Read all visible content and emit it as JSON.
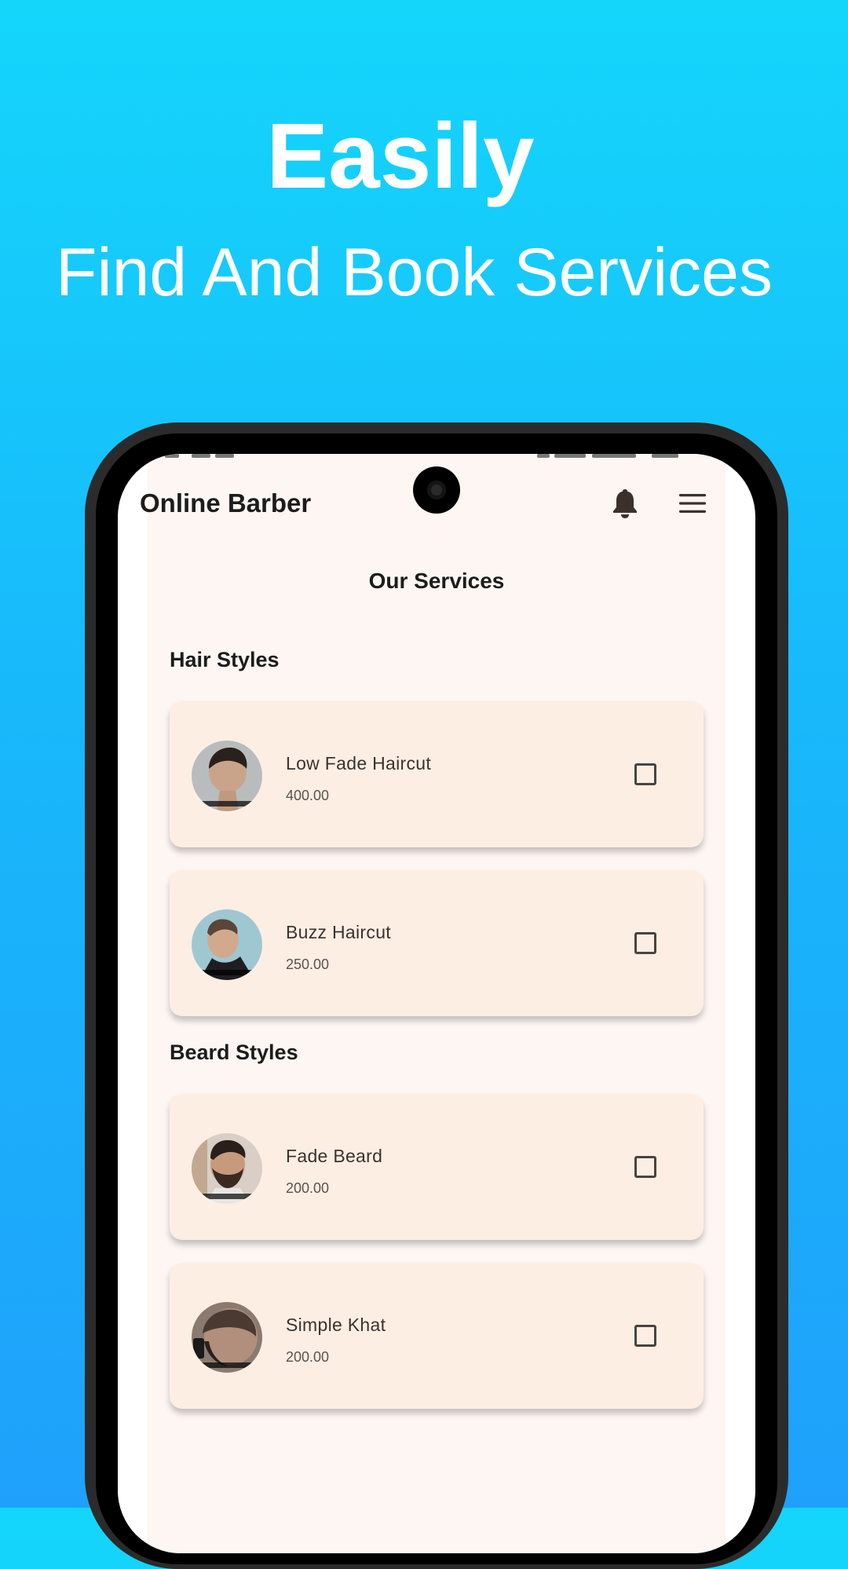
{
  "promo": {
    "headline": "Easily",
    "subheadline": "Find And Book Services"
  },
  "app": {
    "title": "Online Barber",
    "icons": {
      "notifications": "bell-icon",
      "menu": "menu-icon"
    },
    "page_title": "Our Services",
    "sections": [
      {
        "heading": "Hair Styles",
        "services": [
          {
            "name": "Low Fade Haircut",
            "price": "400.00",
            "checked": false
          },
          {
            "name": "Buzz Haircut",
            "price": "250.00",
            "checked": false
          }
        ]
      },
      {
        "heading": "Beard Styles",
        "services": [
          {
            "name": "Fade Beard",
            "price": "200.00",
            "checked": false
          },
          {
            "name": "Simple Khat",
            "price": "200.00",
            "checked": false
          }
        ]
      }
    ]
  },
  "colors": {
    "background_top": "#14d6fb",
    "background_bottom": "#1fa1fb",
    "card": "#fdeee4",
    "app_background": "#fdf6f3",
    "text_dark": "#1c1c1c"
  }
}
